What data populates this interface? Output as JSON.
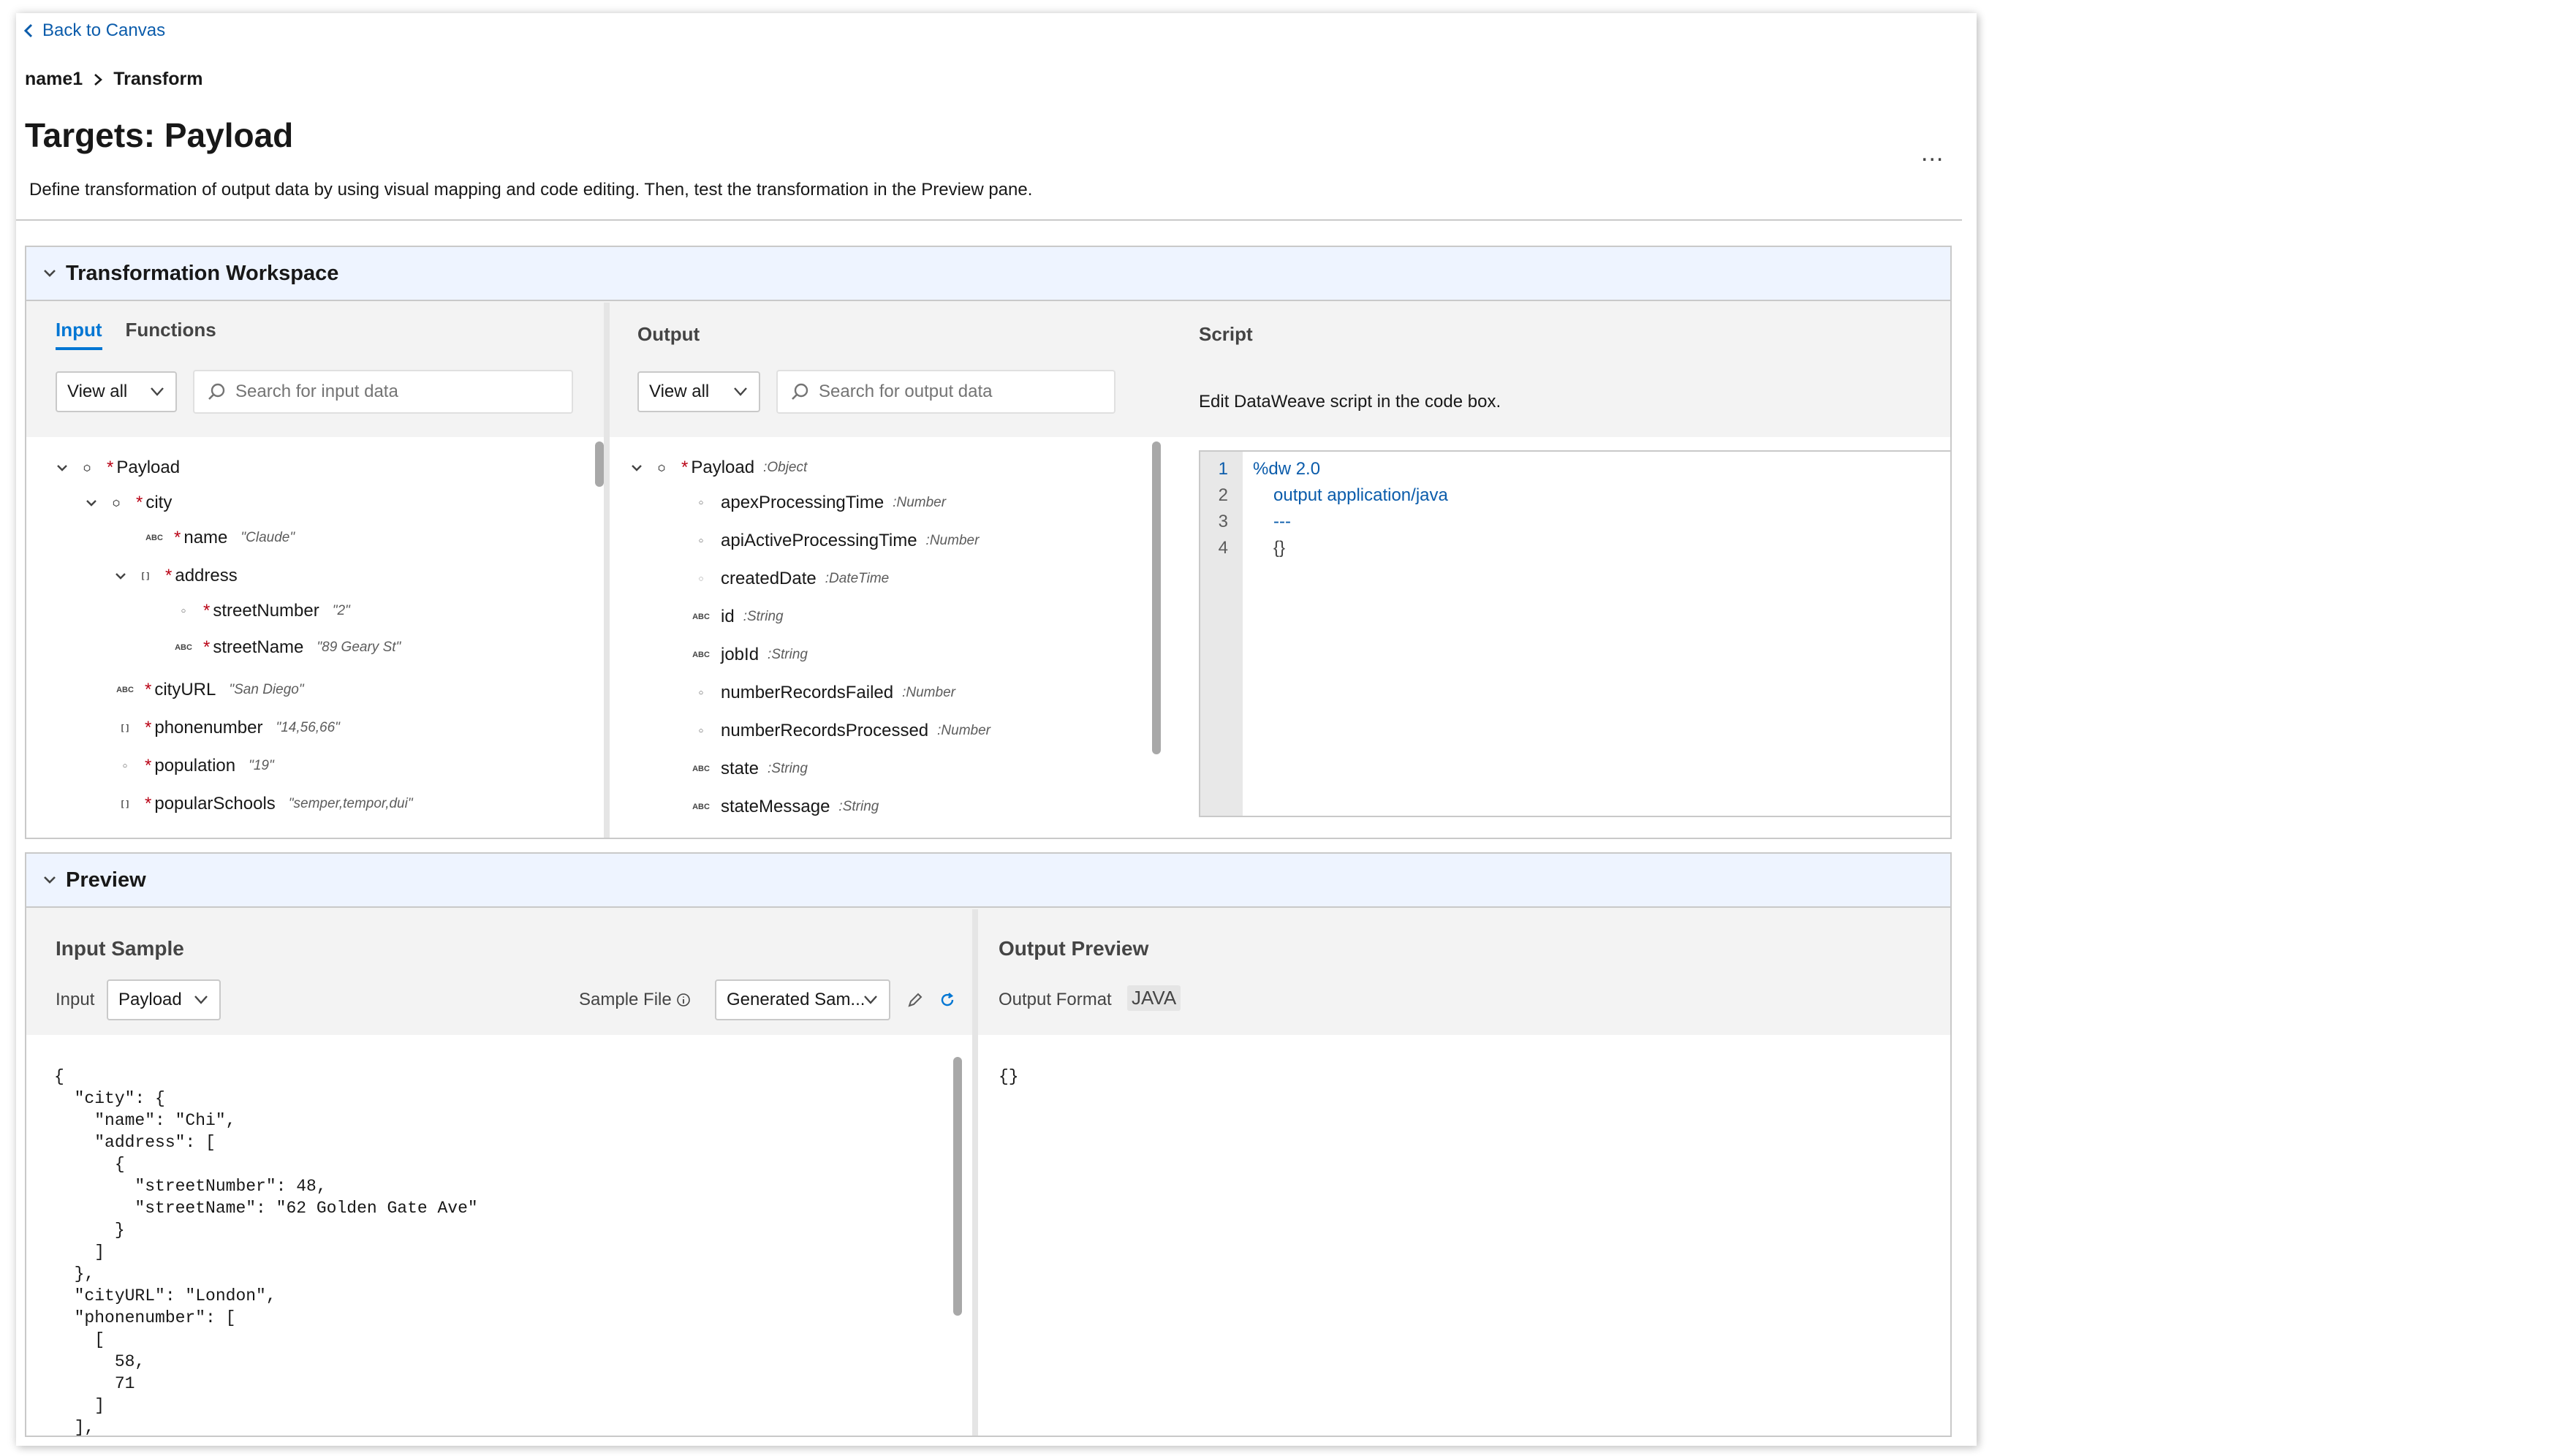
{
  "header": {
    "back_label": "Back to Canvas",
    "breadcrumb": [
      "name1",
      "Transform"
    ],
    "title": "Targets: Payload",
    "more_label": "...",
    "description": "Define transformation of output data by using visual mapping and code editing. Then, test the transformation in the Preview pane."
  },
  "workspace": {
    "title": "Transformation Workspace",
    "input": {
      "tabs": [
        "Input",
        "Functions"
      ],
      "view_select": "View all",
      "search_placeholder": "Search for input data",
      "tree": [
        {
          "label": "Payload",
          "required": true,
          "icon": "object-icon",
          "expanded": true
        },
        {
          "label": "city",
          "required": true,
          "icon": "object-icon",
          "expanded": true
        },
        {
          "label": "name",
          "required": true,
          "icon": "text-icon",
          "sample": "\"Claude\""
        },
        {
          "label": "address",
          "required": true,
          "icon": "list-icon",
          "expanded": true
        },
        {
          "label": "streetNumber",
          "required": true,
          "icon": "number-icon",
          "sample": "\"2\""
        },
        {
          "label": "streetName",
          "required": true,
          "icon": "text-icon",
          "sample": "\"89 Geary St\""
        },
        {
          "label": "cityURL",
          "required": true,
          "icon": "text-icon",
          "sample": "\"San Diego\""
        },
        {
          "label": "phonenumber",
          "required": true,
          "icon": "list-icon",
          "sample": "\"14,56,66\""
        },
        {
          "label": "population",
          "required": true,
          "icon": "number-icon",
          "sample": "\"19\""
        },
        {
          "label": "popularSchools",
          "required": true,
          "icon": "list-icon",
          "sample": "\"semper,tempor,dui\""
        }
      ]
    },
    "output": {
      "label": "Output",
      "view_select": "View all",
      "search_placeholder": "Search for output data",
      "tree": [
        {
          "label": "Payload",
          "required": true,
          "icon": "object-icon",
          "type": ":Object",
          "expanded": true
        },
        {
          "label": "apexProcessingTime",
          "icon": "number-icon",
          "type": ":Number"
        },
        {
          "label": "apiActiveProcessingTime",
          "icon": "number-icon",
          "type": ":Number"
        },
        {
          "label": "createdDate",
          "icon": "datetime-icon",
          "type": ":DateTime"
        },
        {
          "label": "id",
          "icon": "text-icon",
          "type": ":String"
        },
        {
          "label": "jobId",
          "icon": "text-icon",
          "type": ":String"
        },
        {
          "label": "numberRecordsFailed",
          "icon": "number-icon",
          "type": ":Number"
        },
        {
          "label": "numberRecordsProcessed",
          "icon": "number-icon",
          "type": ":Number"
        },
        {
          "label": "state",
          "icon": "text-icon",
          "type": ":String"
        },
        {
          "label": "stateMessage",
          "icon": "text-icon",
          "type": ":String"
        }
      ]
    },
    "script": {
      "label": "Script",
      "description": "Edit DataWeave script in the code box.",
      "lines": [
        "%dw 2.0",
        "output application/java",
        "---",
        "{}"
      ],
      "line_numbers": [
        "1",
        "2",
        "3",
        "4"
      ]
    }
  },
  "preview": {
    "title": "Preview",
    "input_sample": {
      "title": "Input Sample",
      "input_label": "Input",
      "input_select": "Payload",
      "sample_file_label": "Sample File",
      "sample_file_select": "Generated Sam...",
      "json": "{\n  \"city\": {\n    \"name\": \"Chi\",\n    \"address\": [\n      {\n        \"streetNumber\": 48,\n        \"streetName\": \"62 Golden Gate Ave\"\n      }\n    ]\n  },\n  \"cityURL\": \"London\",\n  \"phonenumber\": [\n    [\n      58,\n      71\n    ]\n  ],"
    },
    "output_preview": {
      "title": "Output Preview",
      "format_label": "Output Format",
      "format_value": "JAVA",
      "json": "{}"
    }
  },
  "colors": {
    "accent": "#0176d3",
    "link": "#0b5cab",
    "required": "#ba0517",
    "section_header_bg": "#eef4ff",
    "border": "#c9c9c9"
  }
}
